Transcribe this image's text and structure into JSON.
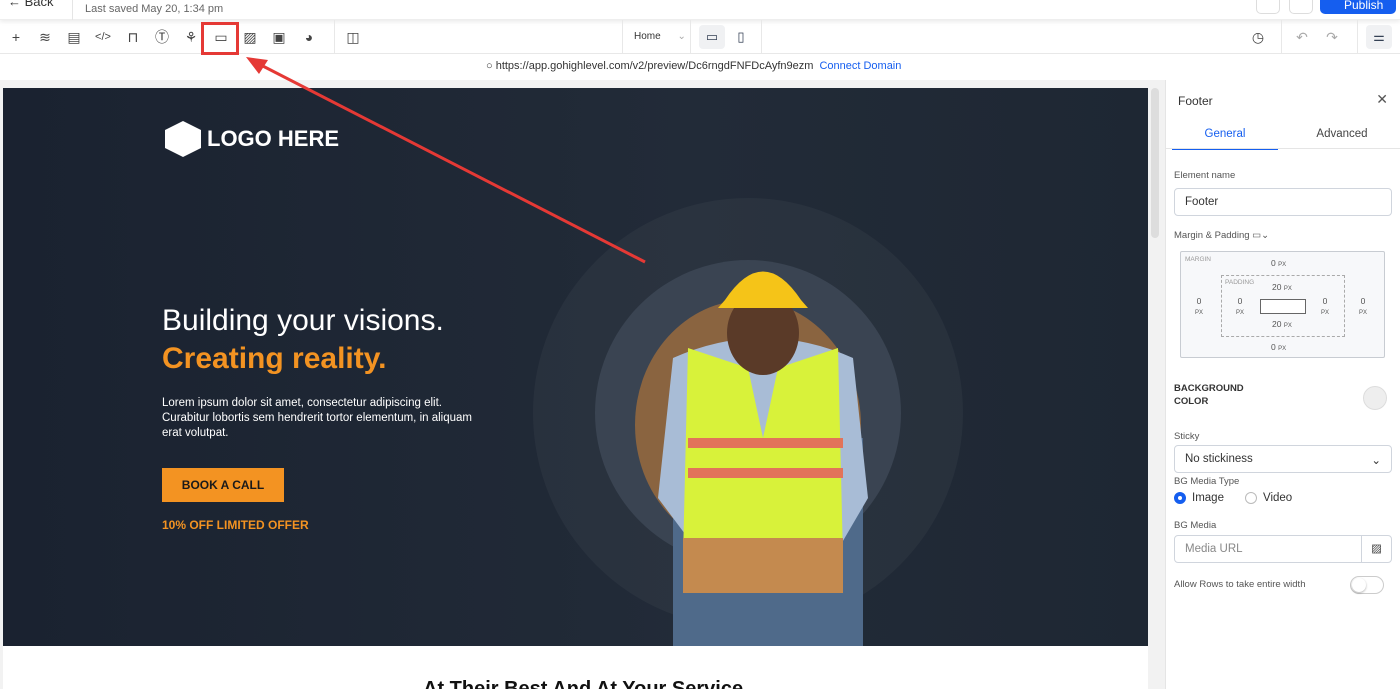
{
  "topbar": {
    "back": "Back",
    "saved": "Last saved May 20, 1:34 pm",
    "publish": "Publish"
  },
  "toolbar": {
    "icons": [
      "plus-icon",
      "layers-icon",
      "pages-icon",
      "code-icon",
      "paint-icon",
      "text-icon",
      "color-icon",
      "section-icon",
      "form-search-icon",
      "terminal-icon",
      "cookie-icon",
      "columns-icon"
    ],
    "page_select": "Home",
    "highlight_color": "#e53935"
  },
  "urlbar": {
    "url": "https://app.gohighlevel.com/v2/preview/Dc6rngdFNFDcAyfn9ezm",
    "connect": "Connect Domain"
  },
  "hero": {
    "logo": "LOGO HERE",
    "headline": "Building your visions.",
    "subheadline": "Creating reality.",
    "body": "Lorem ipsum dolor sit amet, consectetur adipiscing elit. Curabitur lobortis sem hendrerit tortor elementum, in aliquam erat volutpat.",
    "cta": "BOOK A CALL",
    "offer": "10% OFF LIMITED OFFER",
    "accent": "#f39322"
  },
  "next_section": {
    "heading": "At Their Best And At Your Service"
  },
  "panel": {
    "title": "Footer",
    "tabs": [
      "General",
      "Advanced"
    ],
    "element_name_label": "Element name",
    "element_name": "Footer",
    "margin_padding_label": "Margin & Padding",
    "margin_label": "MARGIN",
    "padding_label": "PADDING",
    "margin": {
      "top": "0",
      "right": "0",
      "bottom": "0",
      "left": "0"
    },
    "padding": {
      "top": "20",
      "right": "0",
      "bottom": "20",
      "left": "0"
    },
    "unit": "PX",
    "bg_color_label": "BACKGROUND COLOR",
    "sticky_label": "Sticky",
    "sticky_value": "No stickiness",
    "bg_media_type_label": "BG Media Type",
    "media_types": [
      "Image",
      "Video"
    ],
    "bg_media_label": "BG Media",
    "media_placeholder": "Media URL",
    "full_width_label": "Allow Rows to take entire width"
  }
}
